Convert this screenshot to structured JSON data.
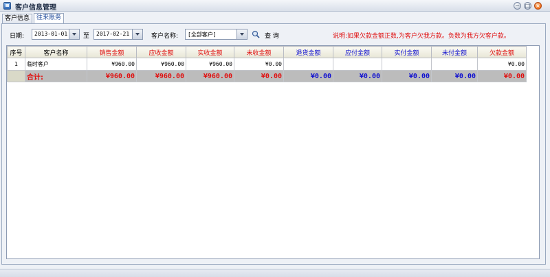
{
  "window": {
    "title": "客户信息管理",
    "controls": [
      "minimize-icon",
      "maximize-icon",
      "close-icon"
    ]
  },
  "tabs": [
    {
      "label": "客户信息",
      "active": false
    },
    {
      "label": "往来账务",
      "active": true
    }
  ],
  "filter": {
    "date_label": "日期:",
    "date_from": "2013-01-01",
    "to_label": "至",
    "date_to": "2017-02-21",
    "customer_label": "客户名称:",
    "customer_value": "[全部客户]",
    "search_label": "查 询",
    "note": "说明:如果欠款金额正数,为客户欠我方款。负数为我方欠客户款。"
  },
  "colors": {
    "red_text": "#e01010",
    "blue_text": "#1010d0",
    "total_row_bg": "#bcbcbc"
  },
  "table": {
    "headers": [
      "序号",
      "客户名称",
      "销售金额",
      "应收金额",
      "实收金额",
      "未收金额",
      "退货金额",
      "应付金额",
      "实付金额",
      "未付金额",
      "欠款金额"
    ],
    "rows": [
      [
        "1",
        "临时客户",
        "¥960.00",
        "¥960.00",
        "¥960.00",
        "¥0.00",
        "",
        "",
        "",
        "",
        "¥0.00"
      ]
    ],
    "total": [
      "",
      "合计:",
      "¥960.00",
      "¥960.00",
      "¥960.00",
      "¥0.00",
      "¥0.00",
      "¥0.00",
      "¥0.00",
      "¥0.00",
      "¥0.00"
    ]
  }
}
